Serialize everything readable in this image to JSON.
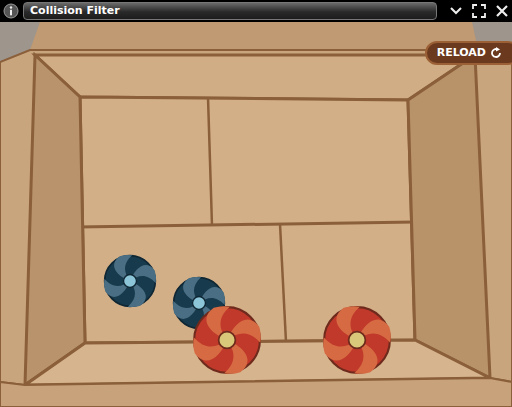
{
  "window": {
    "title": "Collision Filter"
  },
  "reload_button": {
    "label": "RELOAD"
  },
  "balls": [
    {
      "kind": "blue",
      "color": "#173a4c"
    },
    {
      "kind": "blue",
      "color": "#173a4c"
    },
    {
      "kind": "red",
      "color": "#c0392b"
    },
    {
      "kind": "red",
      "color": "#c0392b"
    }
  ]
}
